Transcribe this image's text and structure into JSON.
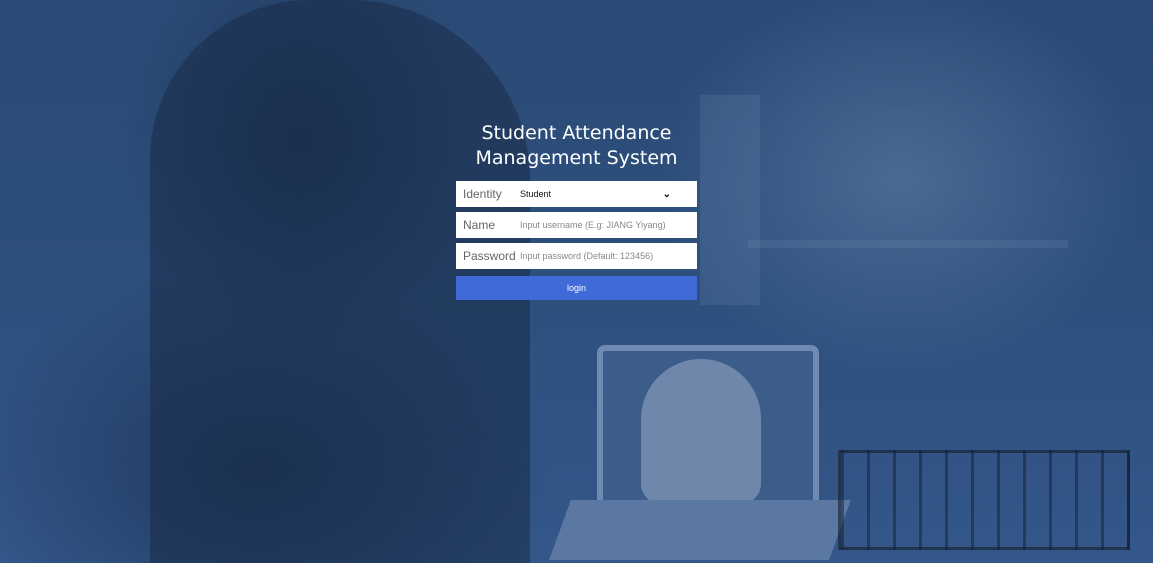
{
  "title": "Student Attendance Management System",
  "form": {
    "identity_label": "Identity",
    "identity_value": "Student",
    "name_label": "Name",
    "name_placeholder": "Input username (E.g: JIANG Yiyang)",
    "password_label": "Password",
    "password_placeholder": "Input password (Default: 123456)",
    "login_label": "login"
  },
  "colors": {
    "background_overlay": "#2b4b76",
    "button": "#3f6ad8",
    "title_text": "#ffffff"
  },
  "icons": {
    "identity_dropdown": "chevron-down-icon"
  }
}
